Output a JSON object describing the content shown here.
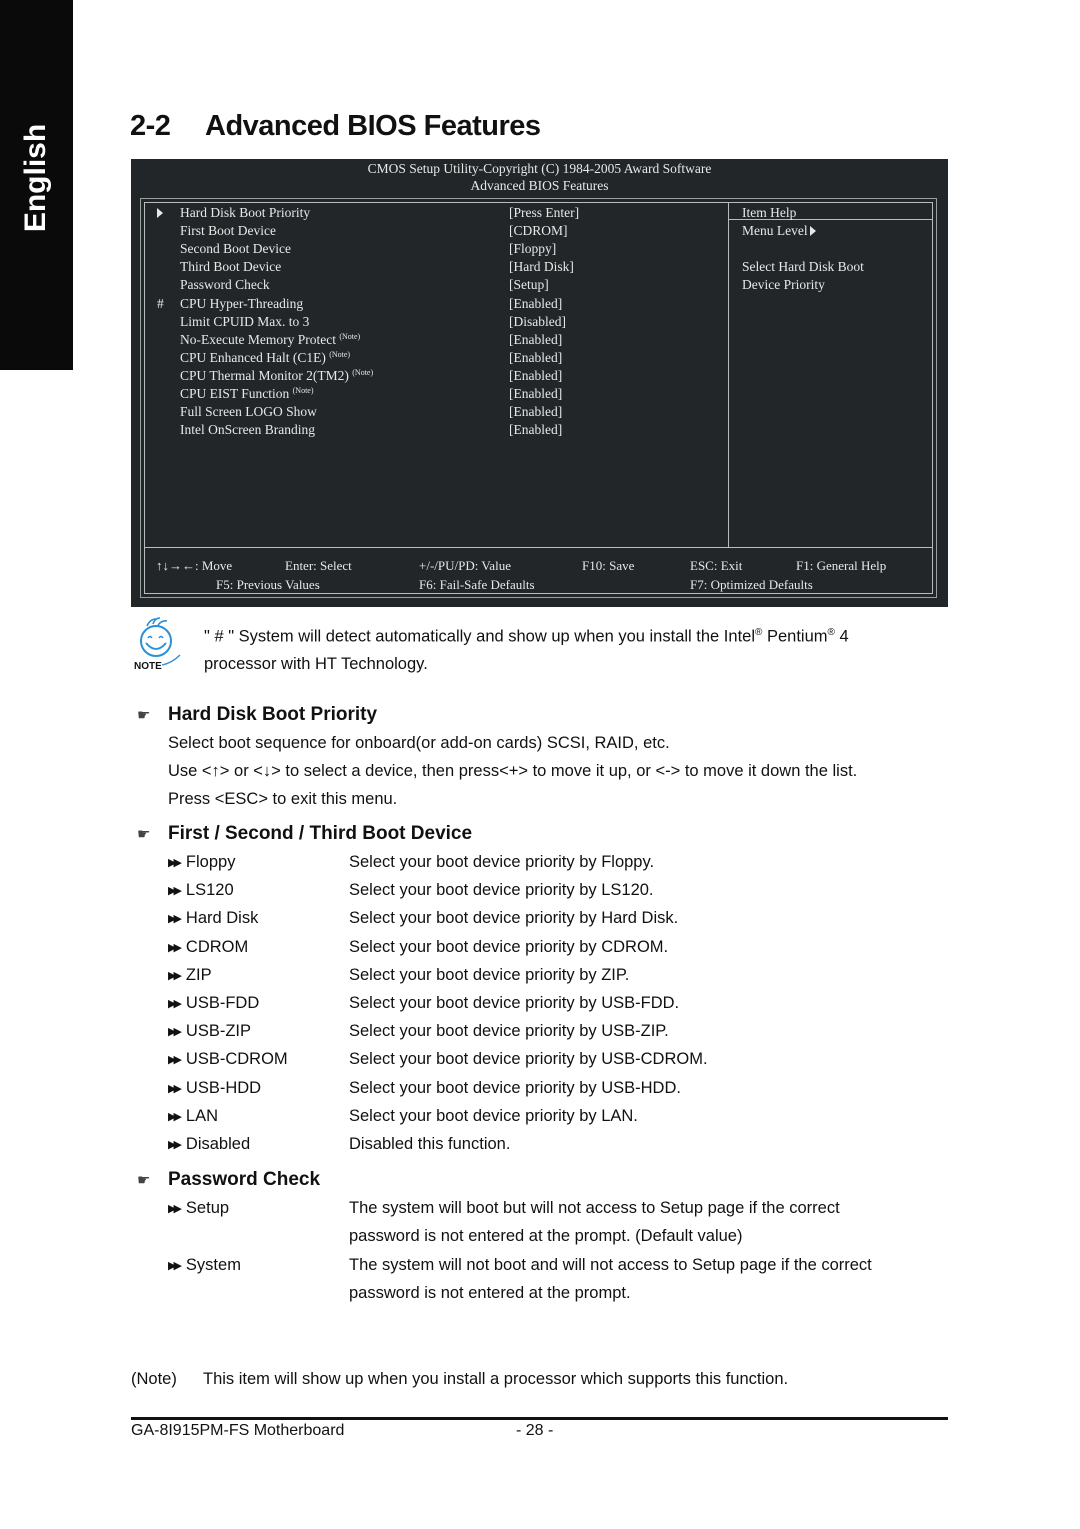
{
  "side_tab": {
    "label": "English"
  },
  "section": {
    "number": "2-2",
    "title": "Advanced BIOS Features"
  },
  "bios": {
    "header_line1": "CMOS Setup Utility-Copyright (C) 1984-2005 Award Software",
    "header_line2": "Advanced BIOS Features",
    "items": [
      {
        "mark": "submenu-arrow",
        "label": "Hard Disk Boot Priority",
        "note": "",
        "value": "[Press Enter]"
      },
      {
        "mark": "",
        "label": "First Boot Device",
        "note": "",
        "value": "[CDROM]"
      },
      {
        "mark": "",
        "label": "Second Boot Device",
        "note": "",
        "value": "[Floppy]"
      },
      {
        "mark": "",
        "label": "Third Boot Device",
        "note": "",
        "value": "[Hard Disk]"
      },
      {
        "mark": "",
        "label": "Password Check",
        "note": "",
        "value": "[Setup]"
      },
      {
        "mark": "#",
        "label": "CPU Hyper-Threading",
        "note": "",
        "value": "[Enabled]"
      },
      {
        "mark": "",
        "label": "Limit CPUID Max. to 3",
        "note": "",
        "value": "[Disabled]"
      },
      {
        "mark": "",
        "label": "No-Execute Memory Protect",
        "note": "(Note)",
        "value": "[Enabled]"
      },
      {
        "mark": "",
        "label": "CPU Enhanced Halt (C1E)",
        "note": "(Note)",
        "value": "[Enabled]"
      },
      {
        "mark": "",
        "label": "CPU Thermal Monitor 2(TM2)",
        "note": "(Note)",
        "value": "[Enabled]"
      },
      {
        "mark": "",
        "label": "CPU EIST Function",
        "note": "(Note)",
        "value": "[Enabled]"
      },
      {
        "mark": "",
        "label": "Full Screen LOGO Show",
        "note": "",
        "value": "[Enabled]"
      },
      {
        "mark": "",
        "label": "Intel OnScreen Branding",
        "note": "",
        "value": "[Enabled]"
      }
    ],
    "help": {
      "title": "Item Help",
      "menu_level": "Menu Level",
      "line1": "Select Hard Disk Boot",
      "line2": "Device Priority"
    },
    "keys_row1": [
      "↑↓→←: Move",
      "Enter: Select",
      "+/-/PU/PD: Value",
      "F10: Save",
      "ESC: Exit",
      "F1: General Help"
    ],
    "keys_row2": [
      "F5: Previous Values",
      "F6: Fail-Safe Defaults",
      "F7: Optimized Defaults"
    ]
  },
  "note": {
    "icon_label": "NOTE",
    "line1_a": "\" # \" System will detect automatically and show up when you install the Intel",
    "reg": "®",
    "line1_b": " Pentium",
    "line1_c": " 4",
    "line2": "processor with HT Technology."
  },
  "hdd_priority": {
    "heading": "Hard Disk Boot Priority",
    "lines": [
      "Select boot sequence for onboard(or add-on cards) SCSI, RAID, etc.",
      "Use <↑> or <↓> to select a device, then press<+> to move it up, or <-> to move it down the list.",
      "Press <ESC> to exit this menu."
    ]
  },
  "boot_device": {
    "heading": "First / Second / Third Boot Device",
    "options": [
      {
        "name": "Floppy",
        "desc": "Select your boot device priority by Floppy."
      },
      {
        "name": "LS120",
        "desc": "Select your boot device priority by LS120."
      },
      {
        "name": "Hard Disk",
        "desc": "Select your boot device priority by Hard Disk."
      },
      {
        "name": "CDROM",
        "desc": "Select your boot device priority by CDROM."
      },
      {
        "name": "ZIP",
        "desc": "Select your boot device priority by ZIP."
      },
      {
        "name": "USB-FDD",
        "desc": "Select your boot device priority by USB-FDD."
      },
      {
        "name": "USB-ZIP",
        "desc": "Select your boot device priority by USB-ZIP."
      },
      {
        "name": "USB-CDROM",
        "desc": "Select your boot device priority by USB-CDROM."
      },
      {
        "name": "USB-HDD",
        "desc": "Select your boot device priority by USB-HDD."
      },
      {
        "name": "LAN",
        "desc": "Select your boot device priority by LAN."
      },
      {
        "name": "Disabled",
        "desc": "Disabled this function."
      }
    ]
  },
  "password_check": {
    "heading": "Password Check",
    "options": [
      {
        "name": "Setup",
        "desc1": "The system will boot but will not access to Setup page if the correct",
        "desc2": "password is not entered at the prompt. (Default value)"
      },
      {
        "name": "System",
        "desc1": "The system will not boot and will not access to Setup page if the correct",
        "desc2": "password is not entered at the prompt."
      }
    ]
  },
  "footnote": {
    "tag": "(Note)",
    "text": "This item will show up when you install a processor which supports this function."
  },
  "footer": {
    "product": "GA-8I915PM-FS Motherboard",
    "page": "- 28 -"
  }
}
